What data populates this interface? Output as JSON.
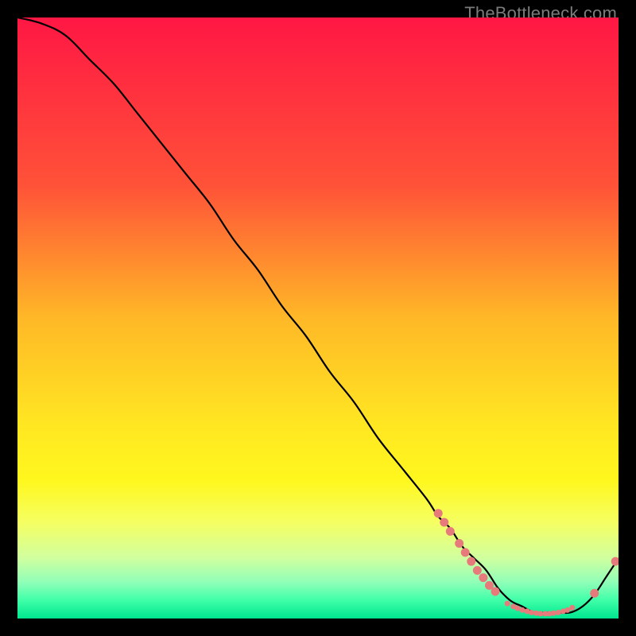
{
  "watermark": {
    "text": "TheBottleneck.com"
  },
  "chart_data": {
    "type": "line",
    "title": "",
    "xlabel": "",
    "ylabel": "",
    "xlim": [
      0,
      100
    ],
    "ylim": [
      0,
      100
    ],
    "grid": false,
    "background_gradient": [
      {
        "stop": 0.0,
        "color": "#ff1744"
      },
      {
        "stop": 0.28,
        "color": "#ff5238"
      },
      {
        "stop": 0.5,
        "color": "#ffb827"
      },
      {
        "stop": 0.68,
        "color": "#ffe722"
      },
      {
        "stop": 0.77,
        "color": "#fff71e"
      },
      {
        "stop": 0.84,
        "color": "#f5ff62"
      },
      {
        "stop": 0.9,
        "color": "#d0ffa0"
      },
      {
        "stop": 0.94,
        "color": "#8fffb8"
      },
      {
        "stop": 0.97,
        "color": "#3effa8"
      },
      {
        "stop": 1.0,
        "color": "#00e58f"
      }
    ],
    "series": [
      {
        "name": "bottleneck-curve",
        "color": "#000000",
        "x": [
          0,
          4,
          8,
          12,
          16,
          20,
          24,
          28,
          32,
          36,
          40,
          44,
          48,
          52,
          56,
          60,
          64,
          68,
          70,
          72,
          74,
          76,
          78,
          80,
          82,
          84,
          86,
          88,
          90,
          92,
          94,
          96,
          98,
          100
        ],
        "y": [
          100,
          99,
          97,
          93,
          89,
          84,
          79,
          74,
          69,
          63,
          58,
          52,
          47,
          41,
          36,
          30,
          25,
          20,
          17,
          15,
          12,
          10,
          8,
          5,
          3,
          2,
          1,
          1,
          1,
          1,
          2,
          4,
          7,
          10
        ]
      }
    ],
    "markers": {
      "name": "recommended-range-markers",
      "color": "#e77b7b",
      "radius_normal": 5.5,
      "radius_small": 3.5,
      "points": [
        {
          "x": 70.0,
          "y": 17.5,
          "size": "normal"
        },
        {
          "x": 71.0,
          "y": 16.0,
          "size": "normal"
        },
        {
          "x": 72.0,
          "y": 14.5,
          "size": "normal"
        },
        {
          "x": 73.5,
          "y": 12.5,
          "size": "normal"
        },
        {
          "x": 74.5,
          "y": 11.0,
          "size": "normal"
        },
        {
          "x": 75.5,
          "y": 9.5,
          "size": "normal"
        },
        {
          "x": 76.5,
          "y": 8.0,
          "size": "normal"
        },
        {
          "x": 77.5,
          "y": 6.8,
          "size": "normal"
        },
        {
          "x": 78.5,
          "y": 5.5,
          "size": "normal"
        },
        {
          "x": 79.5,
          "y": 4.5,
          "size": "normal"
        },
        {
          "x": 81.5,
          "y": 2.5,
          "size": "small"
        },
        {
          "x": 82.5,
          "y": 2.0,
          "size": "small"
        },
        {
          "x": 83.2,
          "y": 1.7,
          "size": "small"
        },
        {
          "x": 84.0,
          "y": 1.4,
          "size": "small"
        },
        {
          "x": 84.8,
          "y": 1.2,
          "size": "small"
        },
        {
          "x": 85.5,
          "y": 1.0,
          "size": "small"
        },
        {
          "x": 86.3,
          "y": 0.9,
          "size": "small"
        },
        {
          "x": 87.0,
          "y": 0.8,
          "size": "small"
        },
        {
          "x": 87.8,
          "y": 0.8,
          "size": "small"
        },
        {
          "x": 88.5,
          "y": 0.8,
          "size": "small"
        },
        {
          "x": 89.2,
          "y": 0.9,
          "size": "small"
        },
        {
          "x": 90.0,
          "y": 1.0,
          "size": "small"
        },
        {
          "x": 90.8,
          "y": 1.2,
          "size": "small"
        },
        {
          "x": 91.5,
          "y": 1.4,
          "size": "small"
        },
        {
          "x": 92.3,
          "y": 1.8,
          "size": "small"
        },
        {
          "x": 96.0,
          "y": 4.2,
          "size": "normal"
        },
        {
          "x": 99.5,
          "y": 9.5,
          "size": "normal"
        }
      ]
    },
    "annotations": []
  }
}
